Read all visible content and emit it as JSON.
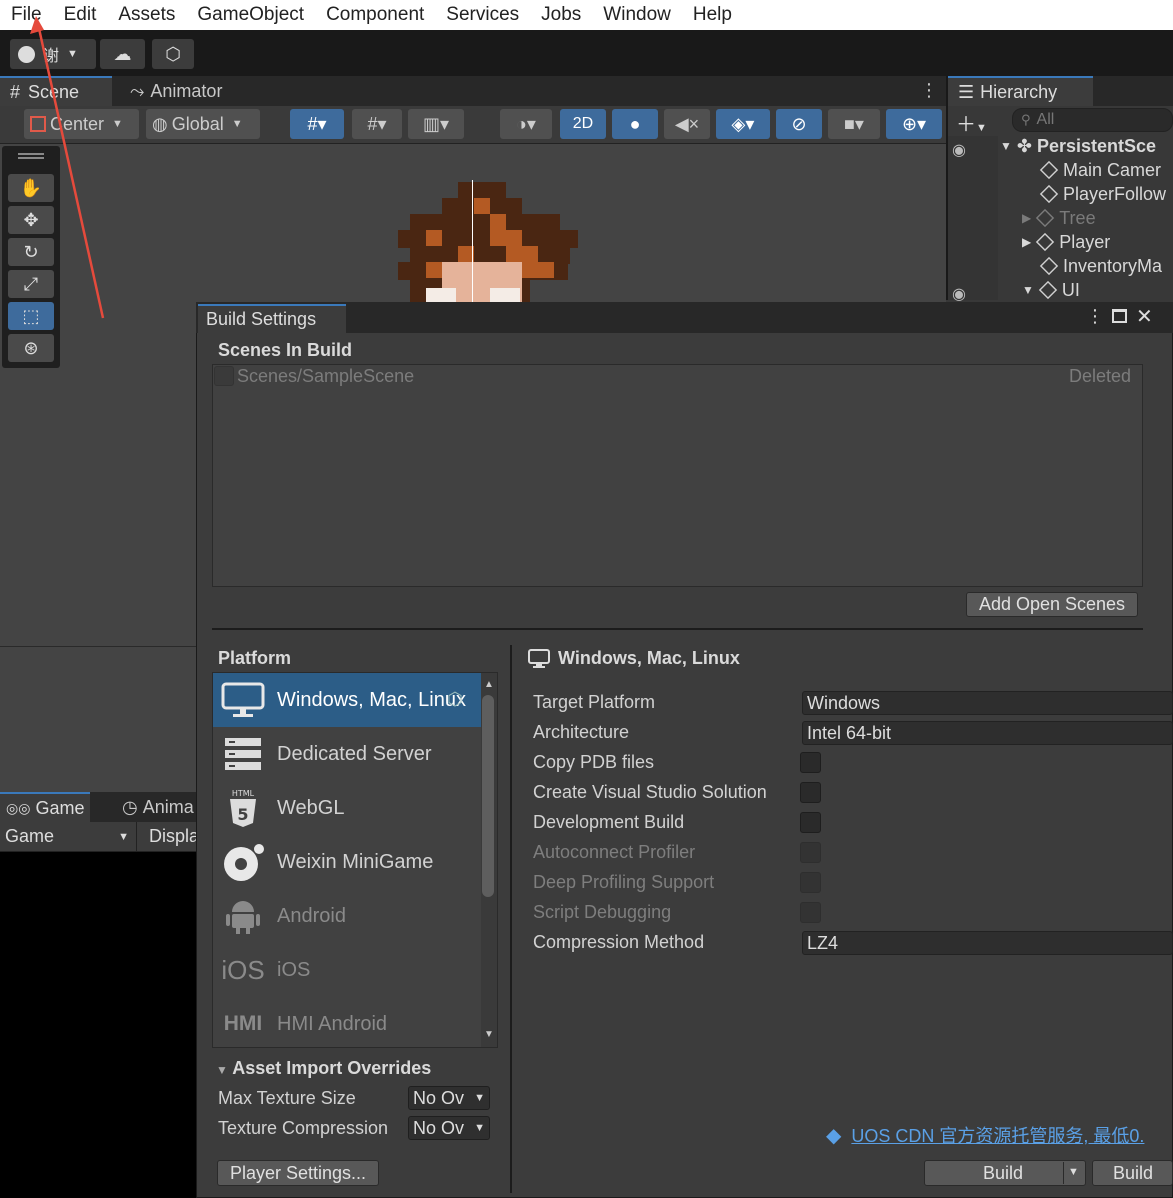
{
  "menubar": {
    "items": [
      "File",
      "Edit",
      "Assets",
      "GameObject",
      "Component",
      "Services",
      "Jobs",
      "Window",
      "Help"
    ]
  },
  "toolbar": {
    "account_label": "谢"
  },
  "scene_tabs": {
    "scene": "Scene",
    "animator": "Animator"
  },
  "scene_toolbar": {
    "pivot": "Center",
    "space": "Global",
    "mode_2d": "2D"
  },
  "hierarchy": {
    "title": "Hierarchy",
    "search_placeholder": "All",
    "root": "PersistentSce",
    "items": [
      "Main Camer",
      "PlayerFollow",
      "Tree",
      "Player",
      "InventoryMa",
      "UI"
    ]
  },
  "game_panel": {
    "tab_game": "Game",
    "tab_anim": "Anima",
    "game_dropdown": "Game",
    "display": "Displa"
  },
  "build_settings": {
    "title": "Build Settings",
    "scenes_header": "Scenes In Build",
    "scene_entry": "Scenes/SampleScene",
    "scene_status": "Deleted",
    "add_open_scenes": "Add Open Scenes",
    "platform_header": "Platform",
    "platforms": [
      {
        "label": "Windows, Mac, Linux",
        "icon": "monitor-icon"
      },
      {
        "label": "Dedicated Server",
        "icon": "server-icon"
      },
      {
        "label": "WebGL",
        "icon": "html5-icon"
      },
      {
        "label": "Weixin MiniGame",
        "icon": "weixin-icon"
      },
      {
        "label": "Android",
        "icon": "android-icon"
      },
      {
        "label": "iOS",
        "icon_text": "iOS"
      },
      {
        "label": "HMI Android",
        "icon_text": "HMI"
      }
    ],
    "selected_platform": "Windows, Mac, Linux",
    "asset_overrides": {
      "header": "Asset Import Overrides",
      "max_texture_label": "Max Texture Size",
      "max_texture_value": "No Ov",
      "tex_comp_label": "Texture Compression",
      "tex_comp_value": "No Ov"
    },
    "player_settings": "Player Settings...",
    "settings": {
      "target_platform_label": "Target Platform",
      "target_platform_value": "Windows",
      "architecture_label": "Architecture",
      "architecture_value": "Intel 64-bit",
      "copy_pdb": "Copy PDB files",
      "create_vs": "Create Visual Studio Solution",
      "dev_build": "Development Build",
      "autoconnect": "Autoconnect Profiler",
      "deep_profiling": "Deep Profiling Support",
      "script_debug": "Script Debugging",
      "compression_label": "Compression Method",
      "compression_value": "LZ4"
    },
    "uos_link": "UOS CDN 官方资源托管服务, 最低0.",
    "build_button": "Build",
    "build_and_run_button": "Build"
  }
}
